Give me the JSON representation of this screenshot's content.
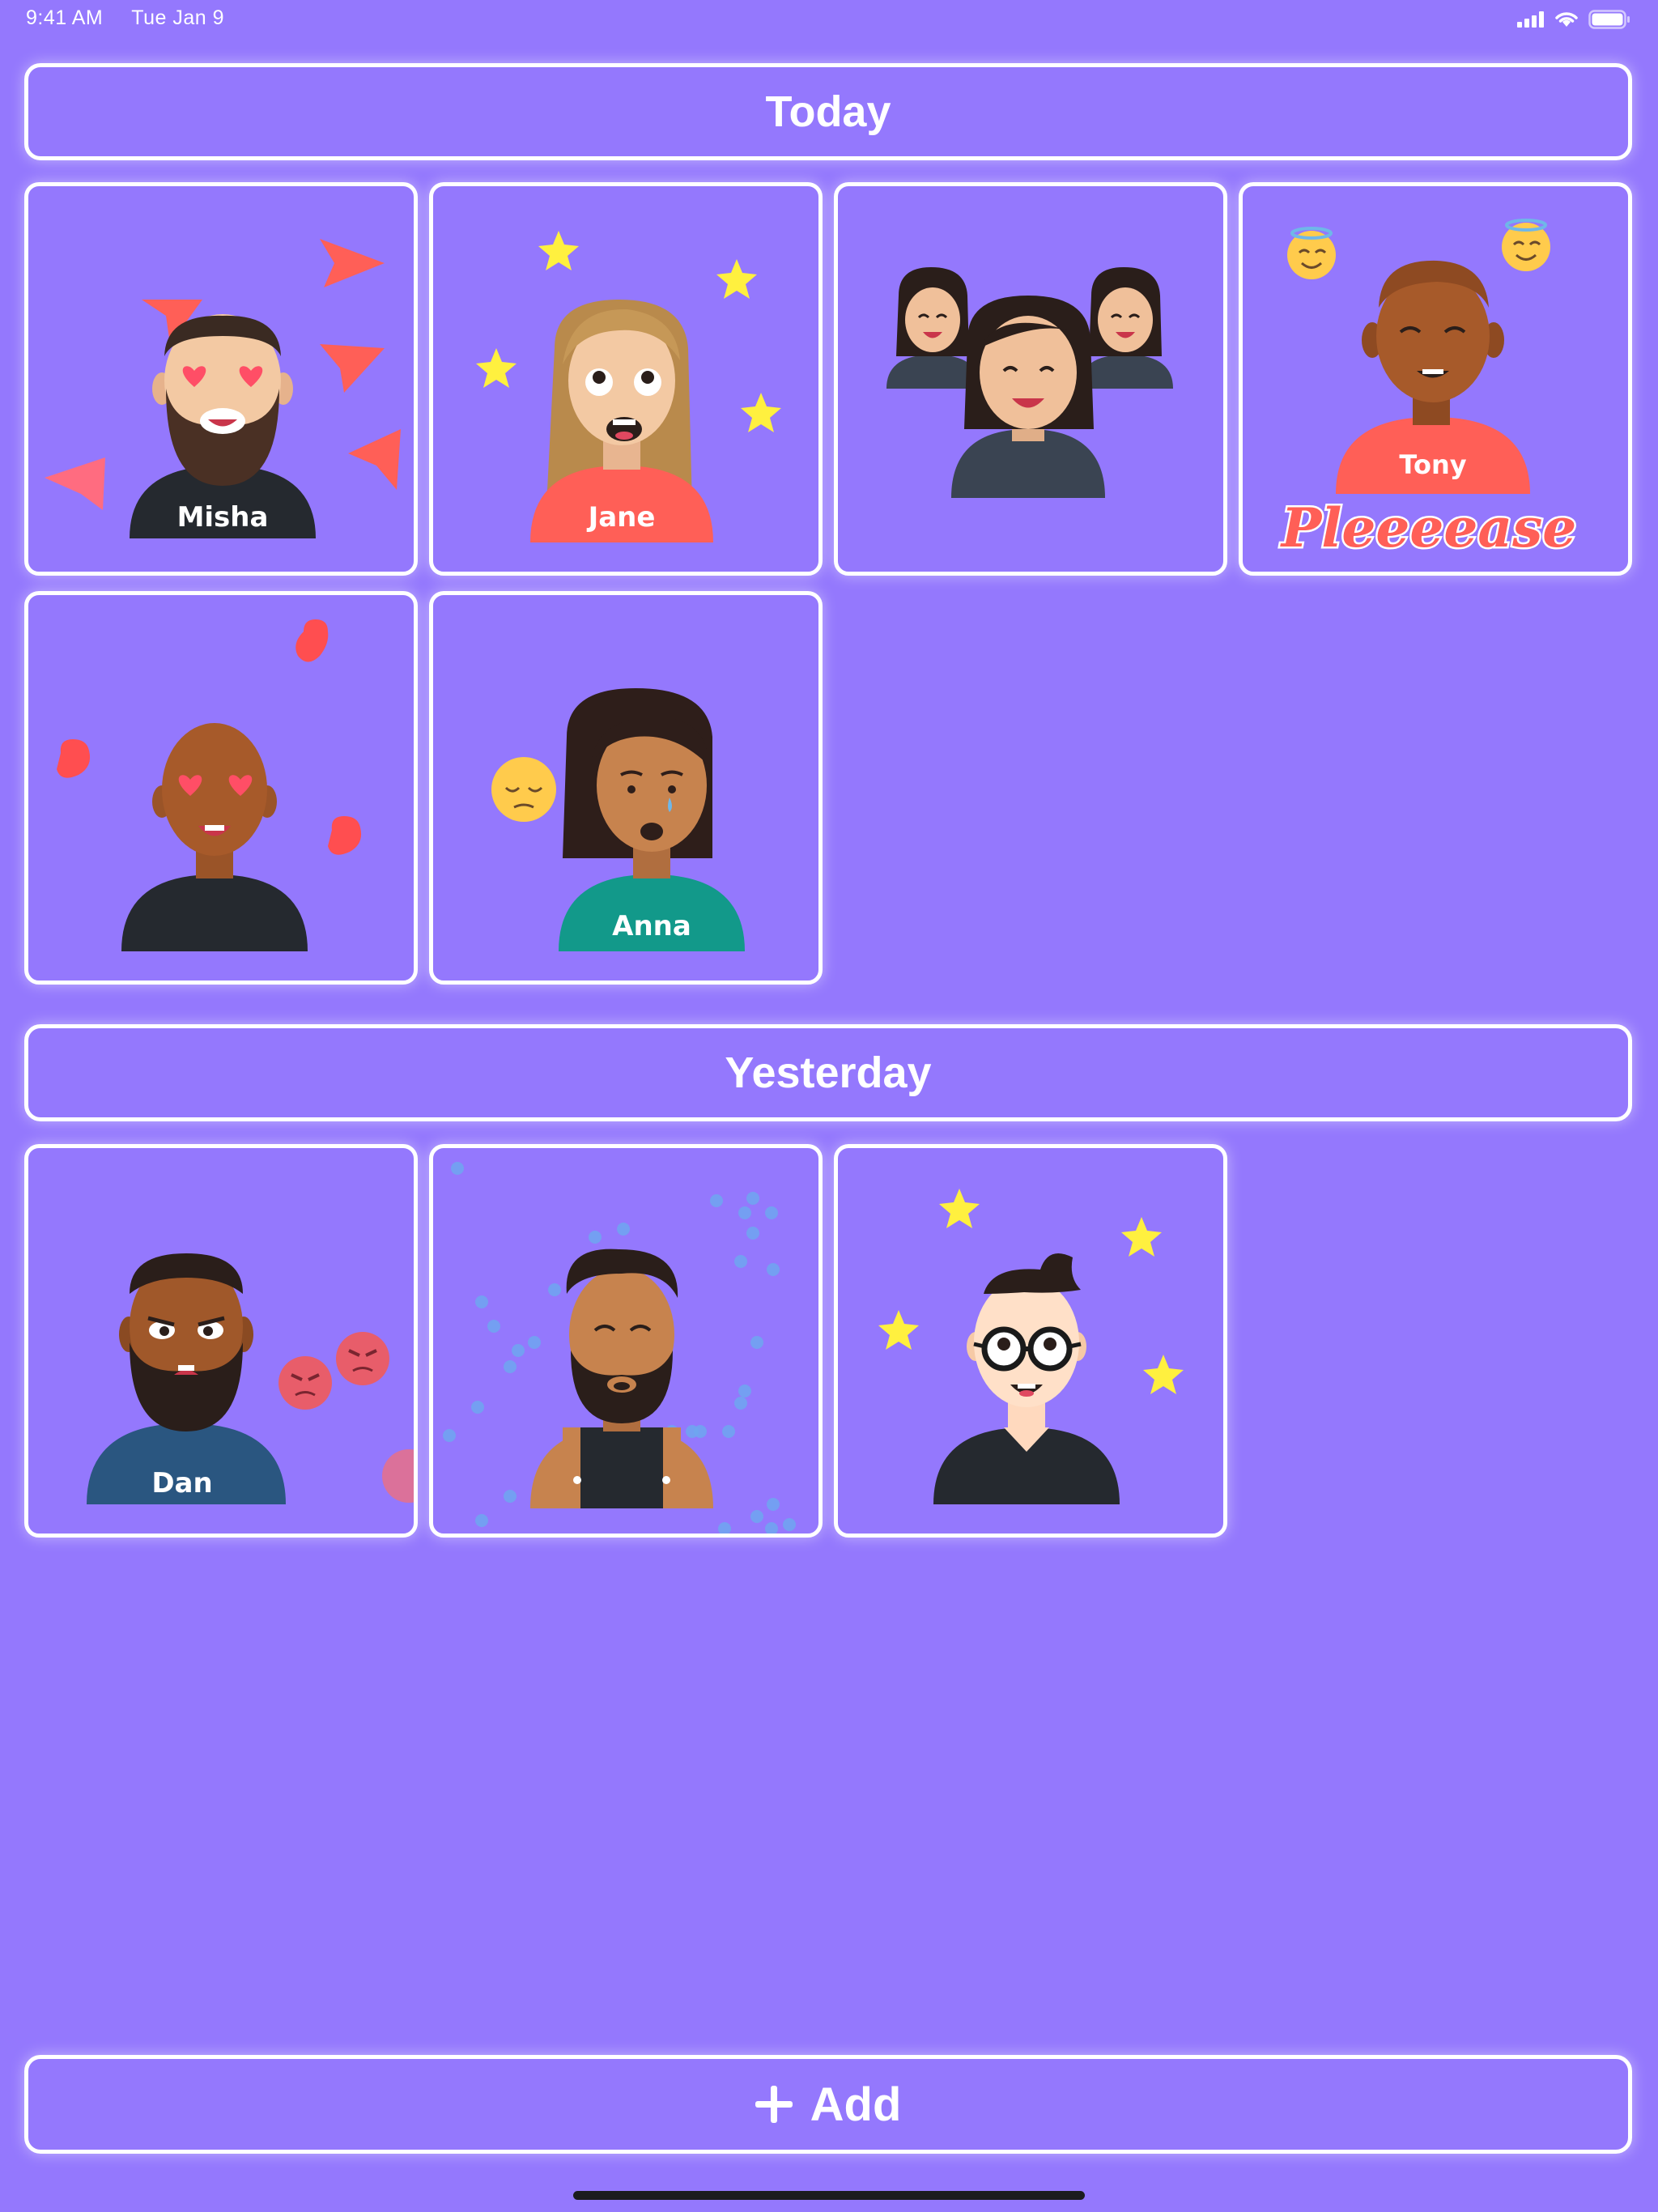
{
  "status_bar": {
    "time": "9:41 AM",
    "date": "Tue Jan 9"
  },
  "sections": {
    "today": {
      "title": "Today"
    },
    "yesterday": {
      "title": "Yesterday"
    }
  },
  "cards": {
    "misha": {
      "name": "Misha"
    },
    "jane": {
      "name": "Jane"
    },
    "tony": {
      "name": "Tony",
      "caption": "Pleeeease"
    },
    "anna": {
      "name": "Anna"
    },
    "dan": {
      "name": "Dan"
    }
  },
  "add_button": {
    "label": "Add"
  },
  "colors": {
    "background": "#9478FD",
    "border": "#FFFFFF",
    "shirt_red": "#FF5F57",
    "shirt_dark": "#25292F",
    "shirt_teal": "#12998A",
    "shirt_blue": "#2A5680"
  }
}
